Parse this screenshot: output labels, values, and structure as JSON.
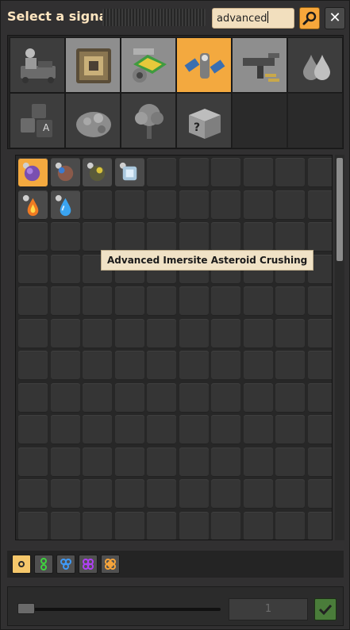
{
  "window": {
    "title": "Select a signal"
  },
  "search": {
    "value": "advanced"
  },
  "groups": [
    {
      "name": "logistics",
      "selected": false
    },
    {
      "name": "production",
      "selected": false
    },
    {
      "name": "intermediate-products",
      "selected": false
    },
    {
      "name": "space",
      "selected": true
    },
    {
      "name": "combat",
      "selected": false
    },
    {
      "name": "fluids",
      "selected": false
    },
    {
      "name": "signals",
      "selected": false
    },
    {
      "name": "enemies",
      "selected": false
    },
    {
      "name": "environment",
      "selected": false
    },
    {
      "name": "unsorted",
      "selected": false
    }
  ],
  "signals": [
    {
      "icon": "imersite-asteroid-crushing-icon",
      "selected": true
    },
    {
      "icon": "metallic-asteroid-crushing-icon",
      "selected": false
    },
    {
      "icon": "carbonic-asteroid-crushing-icon",
      "selected": false
    },
    {
      "icon": "oxide-asteroid-crushing-icon",
      "selected": false
    },
    {
      "icon": "fire-recipe-icon",
      "selected": false
    },
    {
      "icon": "water-recipe-icon",
      "selected": false
    }
  ],
  "tooltip": {
    "text": "Advanced Imersite Asteroid Crushing"
  },
  "quality": [
    {
      "name": "normal",
      "color": "#2b2b2b",
      "selected": true
    },
    {
      "name": "uncommon",
      "color": "#3fd33f",
      "selected": false
    },
    {
      "name": "rare",
      "color": "#3f9af7",
      "selected": false
    },
    {
      "name": "epic",
      "color": "#b03ff5",
      "selected": false
    },
    {
      "name": "legendary",
      "color": "#f7a53b",
      "selected": false
    }
  ],
  "count": {
    "value": "1"
  }
}
